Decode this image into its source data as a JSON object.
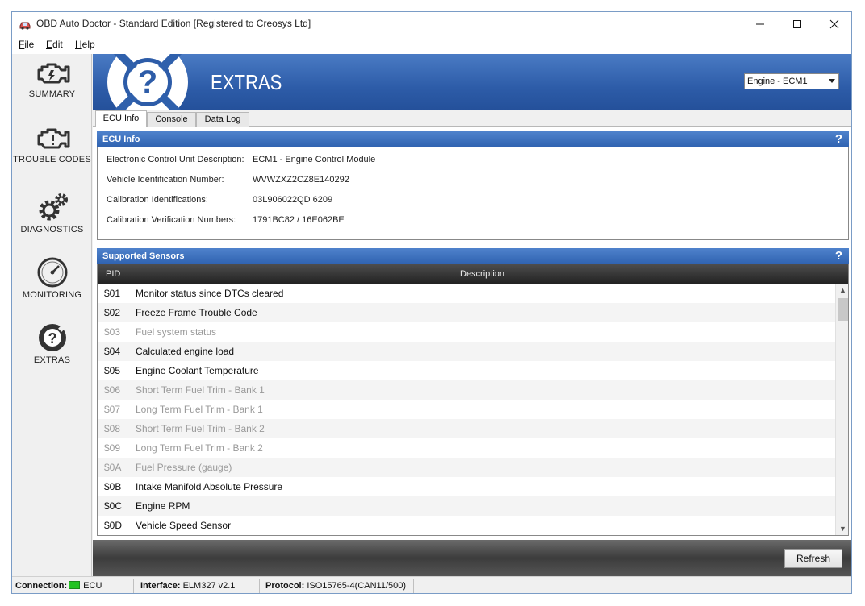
{
  "window": {
    "title": "OBD Auto Doctor - Standard Edition [Registered to Creosys Ltd]"
  },
  "menu": [
    {
      "label": "File",
      "accel": "F",
      "rest": "ile"
    },
    {
      "label": "Edit",
      "accel": "E",
      "rest": "dit"
    },
    {
      "label": "Help",
      "accel": "H",
      "rest": "elp"
    }
  ],
  "nav": {
    "summary": "SUMMARY",
    "trouble_codes": "TROUBLE CODES",
    "diagnostics": "DIAGNOSTICS",
    "monitoring": "MONITORING",
    "extras": "EXTRAS"
  },
  "header": {
    "title": "EXTRAS",
    "ecu_selected": "Engine - ECM1"
  },
  "tabs": [
    {
      "label": "ECU Info",
      "active": true
    },
    {
      "label": "Console",
      "active": false
    },
    {
      "label": "Data Log",
      "active": false
    }
  ],
  "ecu_info": {
    "title": "ECU Info",
    "help": "?",
    "rows": [
      {
        "label": "Electronic Control Unit Description:",
        "value": "ECM1 - Engine Control Module"
      },
      {
        "label": "Vehicle Identification Number:",
        "value": "WVWZXZ2CZ8E140292"
      },
      {
        "label": "Calibration Identifications:",
        "value": "03L906022QD 6209"
      },
      {
        "label": "Calibration Verification Numbers:",
        "value": "1791BC82 / 16E062BE"
      }
    ]
  },
  "sensors": {
    "title": "Supported Sensors",
    "help": "?",
    "columns": {
      "pid": "PID",
      "description": "Description"
    },
    "rows": [
      {
        "pid": "$01",
        "desc": "Monitor status since DTCs cleared",
        "supported": true
      },
      {
        "pid": "$02",
        "desc": "Freeze Frame Trouble Code",
        "supported": true
      },
      {
        "pid": "$03",
        "desc": "Fuel system status",
        "supported": false
      },
      {
        "pid": "$04",
        "desc": "Calculated engine load",
        "supported": true
      },
      {
        "pid": "$05",
        "desc": "Engine Coolant Temperature",
        "supported": true
      },
      {
        "pid": "$06",
        "desc": "Short Term Fuel Trim - Bank 1",
        "supported": false
      },
      {
        "pid": "$07",
        "desc": "Long Term Fuel Trim - Bank 1",
        "supported": false
      },
      {
        "pid": "$08",
        "desc": "Short Term Fuel Trim - Bank 2",
        "supported": false
      },
      {
        "pid": "$09",
        "desc": "Long Term Fuel Trim - Bank 2",
        "supported": false
      },
      {
        "pid": "$0A",
        "desc": "Fuel Pressure (gauge)",
        "supported": false
      },
      {
        "pid": "$0B",
        "desc": "Intake Manifold Absolute Pressure",
        "supported": true
      },
      {
        "pid": "$0C",
        "desc": "Engine RPM",
        "supported": true
      },
      {
        "pid": "$0D",
        "desc": "Vehicle Speed Sensor",
        "supported": true
      }
    ]
  },
  "footer": {
    "refresh_label": "Refresh"
  },
  "status": {
    "connection_label": "Connection:",
    "connection_value": "ECU",
    "interface_label": "Interface:",
    "interface_value": "ELM327 v2.1",
    "protocol_label": "Protocol:",
    "protocol_value": "ISO15765-4(CAN11/500)"
  },
  "colors": {
    "accent": "#2d5ca8",
    "connection_led": "#22c322",
    "unsupported_text": "#9a9a9a"
  }
}
